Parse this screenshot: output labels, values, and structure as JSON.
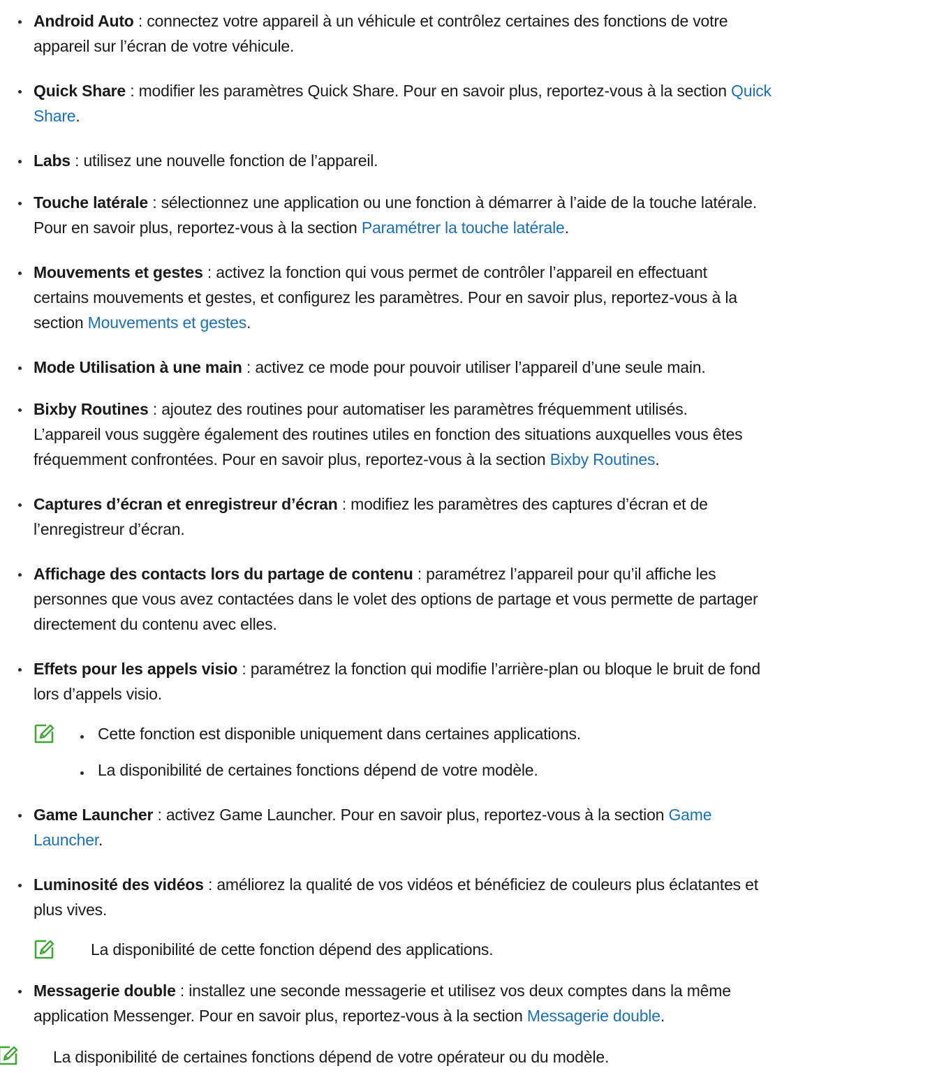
{
  "items": [
    {
      "term": "Android Auto",
      "lines": [
        " : connectez votre appareil à un véhicule et contrôlez certaines des fonctions de votre",
        "appareil sur l’écran de votre véhicule."
      ]
    },
    {
      "term": "Quick Share",
      "line1_text": " : modifier les paramètres Quick Share. Pour en savoir plus, reportez-vous à la section ",
      "link_part1": "Quick",
      "link_part2": "Share",
      "line2_tail": "."
    },
    {
      "term": "Labs",
      "lines": [
        " : utilisez une nouvelle fonction de l’appareil."
      ]
    },
    {
      "term": "Touche latérale",
      "line1": " : sélectionnez une application ou une fonction à démarrer à l’aide de la touche latérale.",
      "line2_text": "Pour en savoir plus, reportez-vous à la section ",
      "link": "Paramétrer la touche latérale",
      "tail": "."
    },
    {
      "term": "Mouvements et gestes",
      "line1": " : activez la fonction qui vous permet de contrôler l’appareil en effectuant",
      "line2": "certains mouvements et gestes, et configurez les paramètres. Pour en savoir plus, reportez-vous à la",
      "line3_text": "section ",
      "link": "Mouvements et gestes",
      "tail": "."
    },
    {
      "term": "Mode Utilisation à une main",
      "lines": [
        " : activez ce mode pour pouvoir utiliser l’appareil d’une seule main."
      ]
    },
    {
      "term": "Bixby Routines",
      "line1": " : ajoutez des routines pour automatiser les paramètres fréquemment utilisés.",
      "line2": "L’appareil vous suggère également des routines utiles en fonction des situations auxquelles vous êtes",
      "line3_text": "fréquemment confrontées. Pour en savoir plus, reportez-vous à la section ",
      "link": "Bixby Routines",
      "tail": "."
    },
    {
      "term": "Captures d’écran et enregistreur d’écran",
      "lines": [
        " : modifiez les paramètres des captures d’écran et de",
        "l’enregistreur d’écran."
      ]
    },
    {
      "term": "Affichage des contacts lors du partage de contenu",
      "lines": [
        " : paramétrez l’appareil pour qu’il affiche les",
        "personnes que vous avez contactées dans le volet des options de partage et vous permette de partager",
        "directement du contenu avec elles."
      ]
    },
    {
      "term": "Effets pour les appels visio",
      "lines": [
        " : paramétrez la fonction qui modifie l’arrière-plan ou bloque le bruit de fond",
        "lors d’appels visio."
      ],
      "notes": [
        "Cette fonction est disponible uniquement dans certaines applications.",
        "La disponibilité de certaines fonctions dépend de votre modèle."
      ]
    },
    {
      "term": "Game Launcher",
      "line1_text": " : activez Game Launcher. Pour en savoir plus, reportez-vous à la section ",
      "link_part1": "Game",
      "link_part2": "Launcher",
      "line2_tail": "."
    },
    {
      "term": "Luminosité des vidéos",
      "lines": [
        " : améliorez la qualité de vos vidéos et bénéficiez de couleurs plus éclatantes et",
        "plus vives."
      ],
      "note": "La disponibilité de cette fonction dépend des applications."
    },
    {
      "term": "Messagerie double",
      "line1": " : installez une seconde messagerie et utilisez vos deux comptes dans la même",
      "line2_text": "application Messenger. Pour en savoir plus, reportez-vous à la section ",
      "link": "Messagerie double",
      "tail": "."
    }
  ],
  "footer_note": "La disponibilité de certaines fonctions dépend de votre opérateur ou du modèle.",
  "colors": {
    "link": "#1c6fb6",
    "note_icon": "#3fa535",
    "text": "#1a1a1a"
  },
  "icons": {
    "note": "note-pencil-icon"
  }
}
